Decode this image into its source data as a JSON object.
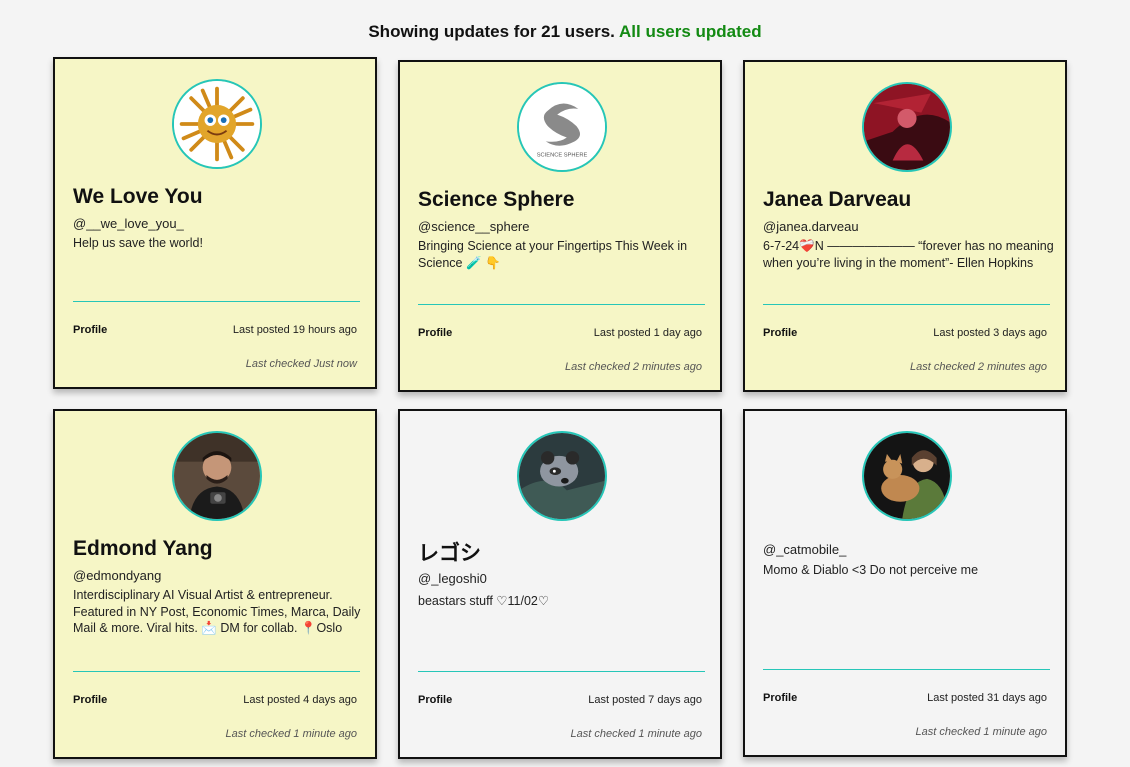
{
  "header": {
    "summary": "Showing updates for 21 users.",
    "status": "All users updated"
  },
  "colors": {
    "accent": "#26c6b8",
    "status_green": "#138a13",
    "card_yellow": "#f6f6c6",
    "card_grey": "#f4f4f4"
  },
  "cards": [
    {
      "name": "We Love You",
      "handle": "@__we_love_you_",
      "bio": "Help us save the world!",
      "profile_label": "Profile",
      "last_posted": "Last posted 19 hours ago",
      "last_checked": "Last checked Just now"
    },
    {
      "name": "Science Sphere",
      "handle": "@science__sphere",
      "bio": "Bringing Science at your Fingertips This Week in Science 🧪 👇",
      "profile_label": "Profile",
      "last_posted": "Last posted 1 day ago",
      "last_checked": "Last checked 2 minutes ago",
      "avatar_text": "SCIENCE SPHERE"
    },
    {
      "name": "Janea Darveau",
      "handle": "@janea.darveau",
      "bio": "6-7-24❤️‍🩹N ——————— “forever has no meaning when you’re living in the moment”- Ellen Hopkins",
      "profile_label": "Profile",
      "last_posted": "Last posted 3 days ago",
      "last_checked": "Last checked 2 minutes ago"
    },
    {
      "name": "Edmond Yang",
      "handle": "@edmondyang",
      "bio": "Interdisciplinary AI Visual Artist & entrepreneur. Featured in NY Post, Economic Times, Marca, Daily Mail & more. Viral hits. 📩 DM for collab. 📍Oslo",
      "profile_label": "Profile",
      "last_posted": "Last posted 4 days ago",
      "last_checked": "Last checked 1 minute ago"
    },
    {
      "name": "レゴシ",
      "handle": "@_legoshi0",
      "bio": "beastars stuff ♡11/02♡",
      "profile_label": "Profile",
      "last_posted": "Last posted 7 days ago",
      "last_checked": "Last checked 1 minute ago"
    },
    {
      "name": "",
      "handle": "@_catmobile_",
      "bio": "Momo & Diablo <3 Do not perceive me",
      "profile_label": "Profile",
      "last_posted": "Last posted 31 days ago",
      "last_checked": "Last checked 1 minute ago"
    }
  ]
}
